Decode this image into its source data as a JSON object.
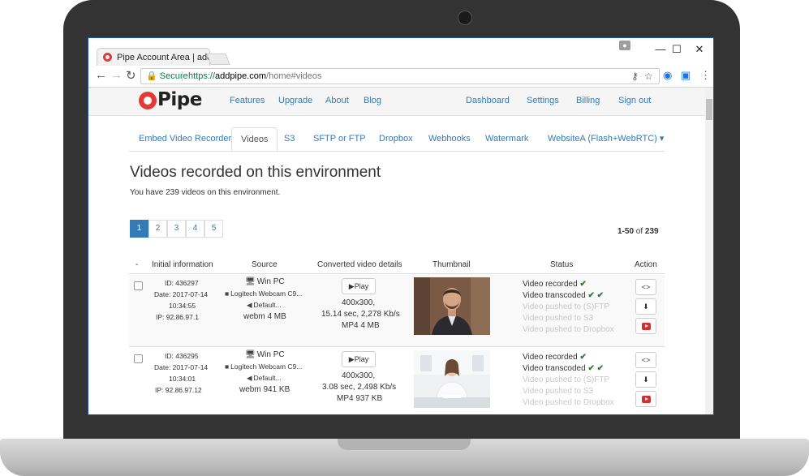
{
  "browser": {
    "tab_title": "Pipe Account Area | add",
    "secure_label": "Secure",
    "url_scheme": "https://",
    "url_host": "addpipe.com",
    "url_path": "/home#videos",
    "win_minimize": "—",
    "win_maximize": "☐",
    "win_close": "✕"
  },
  "site": {
    "logo_text": "Pipe",
    "nav_left": [
      "Features",
      "Upgrade",
      "About",
      "Blog"
    ],
    "nav_right": [
      "Dashboard",
      "Settings",
      "Billing",
      "Sign out"
    ]
  },
  "subtabs": {
    "items": [
      "Embed Video Recorder",
      "Videos",
      "S3",
      "SFTP or FTP",
      "Dropbox",
      "Webhooks",
      "Watermark"
    ],
    "active": "Videos",
    "environment_dropdown": "WebsiteA (Flash+WebRTC) ▾"
  },
  "main": {
    "title": "Videos recorded on this environment",
    "subtitle": "You have 239 videos on this environment.",
    "pages": [
      "1",
      "2",
      "3",
      "4",
      "5"
    ],
    "active_page": "1",
    "range": "1-50",
    "of": "of",
    "total": "239"
  },
  "table": {
    "headers": [
      "-",
      "Initial information",
      "Source",
      "Converted video details",
      "Thumbnail",
      "Status",
      "Action"
    ],
    "rows": [
      {
        "id": "ID: 436297",
        "date": "Date: 2017-07-14",
        "time": "10:34:55",
        "ip": "IP: 92.86.97.1",
        "os": "Win PC",
        "camera": "Logitech Webcam C9...",
        "mic": "Default...",
        "source_size": "webm 4 MB",
        "play_label": "▶Play",
        "resolution": "400x300,",
        "duration": "15.14 sec, 2,278 Kb/s",
        "output": "MP4 4 MB",
        "status": [
          "Video recorded",
          "Video transcoded",
          "Video pushed to (S)FTP",
          "Video pushed to S3",
          "Video pushed to Dropbox"
        ],
        "status_checks": [
          "✔",
          "✔ ✔"
        ]
      },
      {
        "id": "ID: 436295",
        "date": "Date: 2017-07-14",
        "time": "10:34:01",
        "ip": "IP: 92.86.97.12",
        "os": "Win PC",
        "camera": "Logitech Webcam C9...",
        "mic": "Default...",
        "source_size": "webm 941 KB",
        "play_label": "▶Play",
        "resolution": "400x300,",
        "duration": "3.08 sec, 2,498 Kb/s",
        "output": "MP4 937 KB",
        "status": [
          "Video recorded",
          "Video transcoded",
          "Video pushed to (S)FTP",
          "Video pushed to S3",
          "Video pushed to Dropbox"
        ],
        "status_checks": [
          "✔",
          "✔ ✔"
        ]
      }
    ],
    "action_icons": [
      "embed-code-icon",
      "cloud-download-icon",
      "youtube-icon"
    ],
    "action_glyphs": [
      "<>",
      "⬇"
    ]
  },
  "colors": {
    "link": "#337ab7",
    "brand_red": "#e53935",
    "check_green": "#2e7d32",
    "secure_green": "#0b8043"
  }
}
